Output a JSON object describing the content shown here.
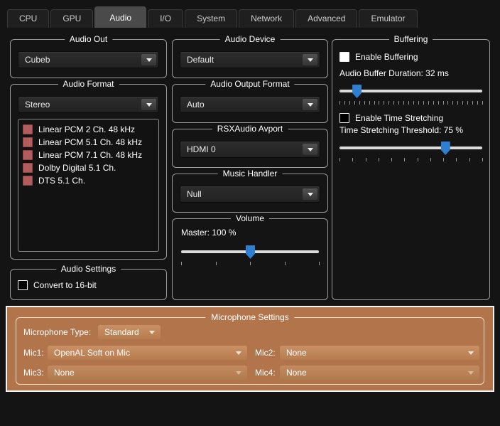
{
  "tabs": {
    "items": [
      {
        "label": "CPU",
        "active": false
      },
      {
        "label": "GPU",
        "active": false
      },
      {
        "label": "Audio",
        "active": true
      },
      {
        "label": "I/O",
        "active": false
      },
      {
        "label": "System",
        "active": false
      },
      {
        "label": "Network",
        "active": false
      },
      {
        "label": "Advanced",
        "active": false
      },
      {
        "label": "Emulator",
        "active": false
      }
    ]
  },
  "audio_out": {
    "title": "Audio Out",
    "value": "Cubeb"
  },
  "audio_format": {
    "title": "Audio Format",
    "value": "Stereo",
    "formats": [
      "Linear PCM 2 Ch. 48 kHz",
      "Linear PCM 5.1 Ch. 48 kHz",
      "Linear PCM 7.1 Ch. 48 kHz",
      "Dolby Digital 5.1 Ch.",
      "DTS 5.1 Ch."
    ]
  },
  "audio_settings": {
    "title": "Audio Settings",
    "convert_checkbox": {
      "label": "Convert to 16-bit",
      "checked": false
    }
  },
  "audio_device": {
    "title": "Audio Device",
    "value": "Default"
  },
  "audio_output_format": {
    "title": "Audio Output Format",
    "value": "Auto"
  },
  "rsxaudio_avport": {
    "title": "RSXAudio Avport",
    "value": "HDMI 0"
  },
  "music_handler": {
    "title": "Music Handler",
    "value": "Null"
  },
  "volume": {
    "title": "Volume",
    "master_label": "Master: 100 %",
    "percent": 50
  },
  "buffering": {
    "title": "Buffering",
    "enable_buffering": {
      "label": "Enable Buffering",
      "checked": true
    },
    "buffer_duration_label": "Audio Buffer Duration: 32 ms",
    "buffer_percent": 12,
    "enable_time_stretching": {
      "label": "Enable Time Stretching",
      "checked": false
    },
    "threshold_label": "Time Stretching Threshold: 75 %",
    "threshold_percent": 74
  },
  "microphone": {
    "title": "Microphone Settings",
    "type_label": "Microphone Type:",
    "type_value": "Standard",
    "mics": [
      {
        "label": "Mic1:",
        "value": "OpenAL Soft on Mic",
        "disabled": false
      },
      {
        "label": "Mic2:",
        "value": "None",
        "disabled": false
      },
      {
        "label": "Mic3:",
        "value": "None",
        "disabled": true
      },
      {
        "label": "Mic4:",
        "value": "None",
        "disabled": true
      }
    ],
    "highlight_color": "#b1744b"
  },
  "colors": {
    "background": "#141414",
    "accent_blue": "#2e7fd0",
    "highlight_orange": "#b1744b",
    "format_checkbox_red": "#b25c5c",
    "group_border": "#9b9b9b"
  }
}
